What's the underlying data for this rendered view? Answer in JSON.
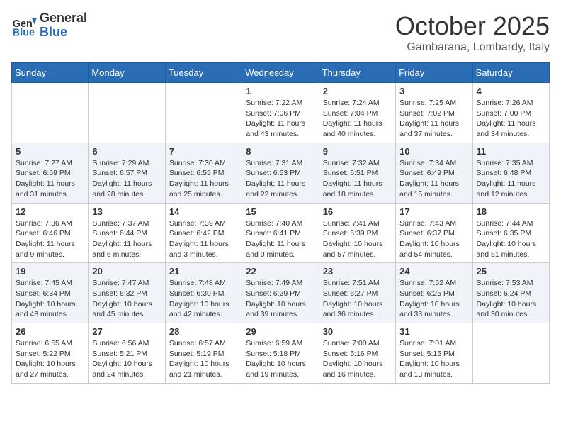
{
  "header": {
    "logo_general": "General",
    "logo_blue": "Blue",
    "month_title": "October 2025",
    "location": "Gambarana, Lombardy, Italy"
  },
  "days_of_week": [
    "Sunday",
    "Monday",
    "Tuesday",
    "Wednesday",
    "Thursday",
    "Friday",
    "Saturday"
  ],
  "weeks": [
    [
      {
        "day": "",
        "info": ""
      },
      {
        "day": "",
        "info": ""
      },
      {
        "day": "",
        "info": ""
      },
      {
        "day": "1",
        "info": "Sunrise: 7:22 AM\nSunset: 7:06 PM\nDaylight: 11 hours and 43 minutes."
      },
      {
        "day": "2",
        "info": "Sunrise: 7:24 AM\nSunset: 7:04 PM\nDaylight: 11 hours and 40 minutes."
      },
      {
        "day": "3",
        "info": "Sunrise: 7:25 AM\nSunset: 7:02 PM\nDaylight: 11 hours and 37 minutes."
      },
      {
        "day": "4",
        "info": "Sunrise: 7:26 AM\nSunset: 7:00 PM\nDaylight: 11 hours and 34 minutes."
      }
    ],
    [
      {
        "day": "5",
        "info": "Sunrise: 7:27 AM\nSunset: 6:59 PM\nDaylight: 11 hours and 31 minutes."
      },
      {
        "day": "6",
        "info": "Sunrise: 7:29 AM\nSunset: 6:57 PM\nDaylight: 11 hours and 28 minutes."
      },
      {
        "day": "7",
        "info": "Sunrise: 7:30 AM\nSunset: 6:55 PM\nDaylight: 11 hours and 25 minutes."
      },
      {
        "day": "8",
        "info": "Sunrise: 7:31 AM\nSunset: 6:53 PM\nDaylight: 11 hours and 22 minutes."
      },
      {
        "day": "9",
        "info": "Sunrise: 7:32 AM\nSunset: 6:51 PM\nDaylight: 11 hours and 18 minutes."
      },
      {
        "day": "10",
        "info": "Sunrise: 7:34 AM\nSunset: 6:49 PM\nDaylight: 11 hours and 15 minutes."
      },
      {
        "day": "11",
        "info": "Sunrise: 7:35 AM\nSunset: 6:48 PM\nDaylight: 11 hours and 12 minutes."
      }
    ],
    [
      {
        "day": "12",
        "info": "Sunrise: 7:36 AM\nSunset: 6:46 PM\nDaylight: 11 hours and 9 minutes."
      },
      {
        "day": "13",
        "info": "Sunrise: 7:37 AM\nSunset: 6:44 PM\nDaylight: 11 hours and 6 minutes."
      },
      {
        "day": "14",
        "info": "Sunrise: 7:39 AM\nSunset: 6:42 PM\nDaylight: 11 hours and 3 minutes."
      },
      {
        "day": "15",
        "info": "Sunrise: 7:40 AM\nSunset: 6:41 PM\nDaylight: 11 hours and 0 minutes."
      },
      {
        "day": "16",
        "info": "Sunrise: 7:41 AM\nSunset: 6:39 PM\nDaylight: 10 hours and 57 minutes."
      },
      {
        "day": "17",
        "info": "Sunrise: 7:43 AM\nSunset: 6:37 PM\nDaylight: 10 hours and 54 minutes."
      },
      {
        "day": "18",
        "info": "Sunrise: 7:44 AM\nSunset: 6:35 PM\nDaylight: 10 hours and 51 minutes."
      }
    ],
    [
      {
        "day": "19",
        "info": "Sunrise: 7:45 AM\nSunset: 6:34 PM\nDaylight: 10 hours and 48 minutes."
      },
      {
        "day": "20",
        "info": "Sunrise: 7:47 AM\nSunset: 6:32 PM\nDaylight: 10 hours and 45 minutes."
      },
      {
        "day": "21",
        "info": "Sunrise: 7:48 AM\nSunset: 6:30 PM\nDaylight: 10 hours and 42 minutes."
      },
      {
        "day": "22",
        "info": "Sunrise: 7:49 AM\nSunset: 6:29 PM\nDaylight: 10 hours and 39 minutes."
      },
      {
        "day": "23",
        "info": "Sunrise: 7:51 AM\nSunset: 6:27 PM\nDaylight: 10 hours and 36 minutes."
      },
      {
        "day": "24",
        "info": "Sunrise: 7:52 AM\nSunset: 6:25 PM\nDaylight: 10 hours and 33 minutes."
      },
      {
        "day": "25",
        "info": "Sunrise: 7:53 AM\nSunset: 6:24 PM\nDaylight: 10 hours and 30 minutes."
      }
    ],
    [
      {
        "day": "26",
        "info": "Sunrise: 6:55 AM\nSunset: 5:22 PM\nDaylight: 10 hours and 27 minutes."
      },
      {
        "day": "27",
        "info": "Sunrise: 6:56 AM\nSunset: 5:21 PM\nDaylight: 10 hours and 24 minutes."
      },
      {
        "day": "28",
        "info": "Sunrise: 6:57 AM\nSunset: 5:19 PM\nDaylight: 10 hours and 21 minutes."
      },
      {
        "day": "29",
        "info": "Sunrise: 6:59 AM\nSunset: 5:18 PM\nDaylight: 10 hours and 19 minutes."
      },
      {
        "day": "30",
        "info": "Sunrise: 7:00 AM\nSunset: 5:16 PM\nDaylight: 10 hours and 16 minutes."
      },
      {
        "day": "31",
        "info": "Sunrise: 7:01 AM\nSunset: 5:15 PM\nDaylight: 10 hours and 13 minutes."
      },
      {
        "day": "",
        "info": ""
      }
    ]
  ]
}
